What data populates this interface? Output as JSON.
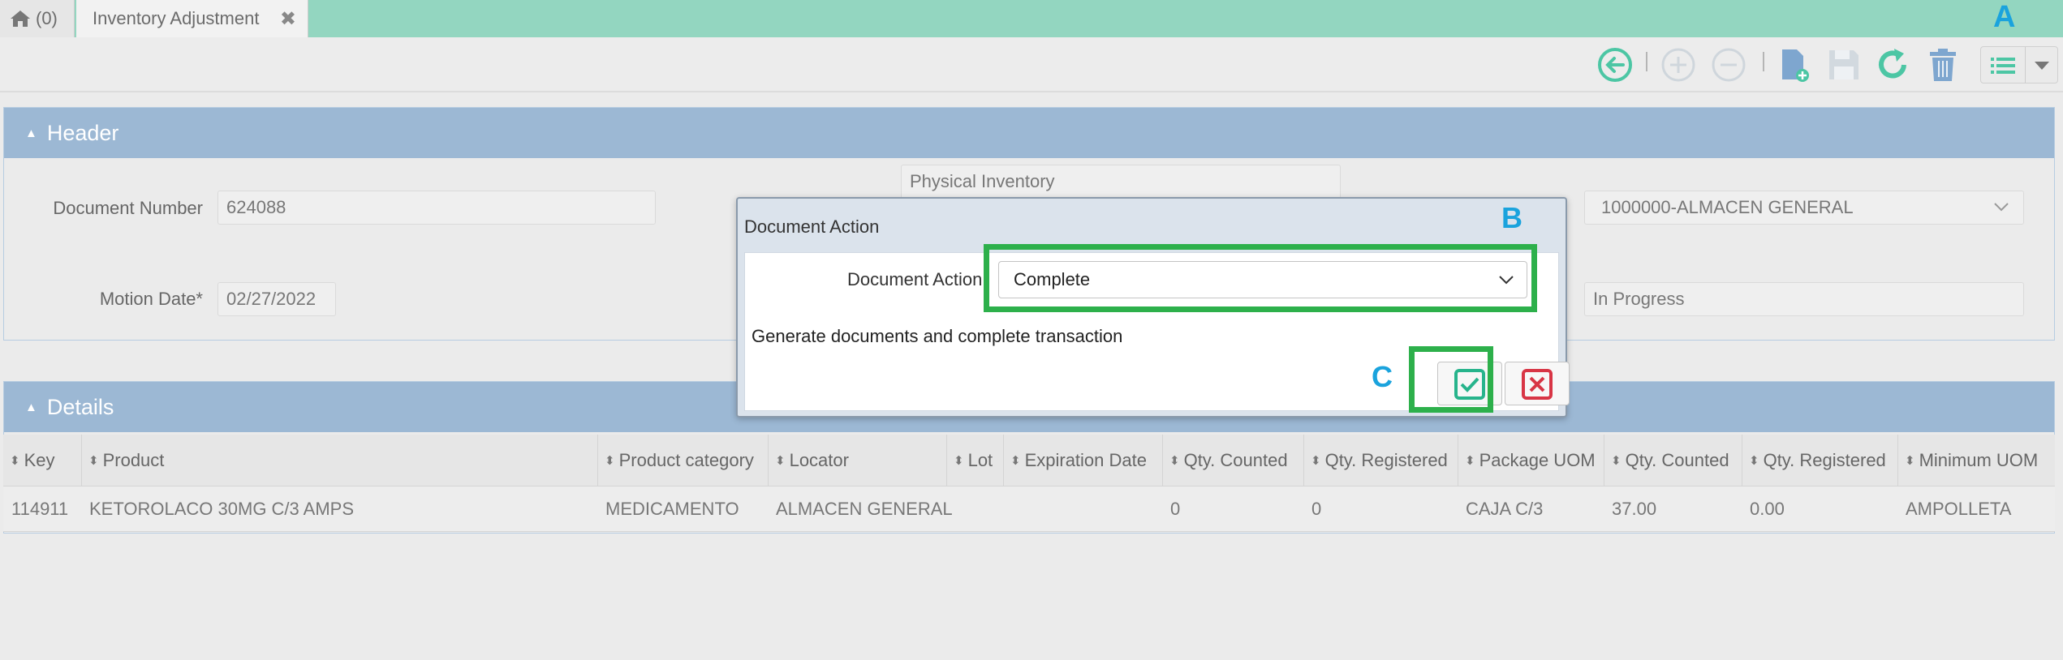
{
  "tabs": {
    "home_label": "(0)",
    "active_label": "Inventory Adjustment"
  },
  "markers": {
    "a": "A",
    "b": "B",
    "c": "C"
  },
  "header": {
    "title": "Header",
    "document_number_label": "Document Number",
    "document_number_value": "624088",
    "doc_type_value": "Physical Inventory",
    "warehouse_value": "1000000-ALMACEN GENERAL",
    "motion_date_label": "Motion Date*",
    "motion_date_value": "02/27/2022",
    "status_value": "In Progress"
  },
  "dialog": {
    "title": "Document Action",
    "action_label": "Document Action",
    "action_value": "Complete",
    "description": "Generate documents and complete transaction"
  },
  "details": {
    "title": "Details",
    "columns": [
      "Key",
      "Product",
      "Product category",
      "Locator",
      "Lot",
      "Expiration Date",
      "Qty. Counted",
      "Qty. Registered",
      "Package UOM",
      "Qty. Counted",
      "Qty. Registered",
      "Minimum UOM"
    ],
    "rows": [
      [
        "114911",
        "KETOROLACO 30MG C/3 AMPS",
        "MEDICAMENTO",
        "ALMACEN GENERAL",
        "",
        "",
        "0",
        "0",
        "CAJA C/3",
        "37.00",
        "0.00",
        "AMPOLLETA"
      ]
    ]
  },
  "colors": {
    "tabbar": "#93d6c0",
    "panel_header": "#9cb8d4",
    "highlight": "#2db04b",
    "marker": "#1aa3dd",
    "ok_green": "#27b48c",
    "cancel_red": "#d83545"
  },
  "icons": [
    "home-icon",
    "close-icon",
    "back-icon",
    "add-row-icon",
    "remove-row-icon",
    "new-document-icon",
    "save-icon",
    "refresh-icon",
    "delete-icon",
    "list-icon",
    "chevron-down-icon",
    "sort-icon",
    "check-icon",
    "cancel-x-icon"
  ]
}
